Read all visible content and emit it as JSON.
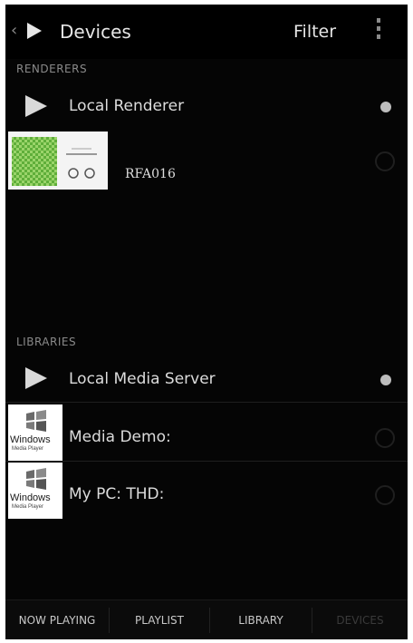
{
  "actionbar": {
    "title": "Devices",
    "filter_label": "Filter"
  },
  "renderers": {
    "header": "RENDERERS",
    "items": [
      {
        "label": "Local Renderer",
        "selected": true
      },
      {
        "label": "RFA016",
        "selected": false
      }
    ]
  },
  "libraries": {
    "header": "LIBRARIES",
    "items": [
      {
        "label": "Local Media Server",
        "selected": true
      },
      {
        "label": "Media Demo:",
        "selected": false
      },
      {
        "label": "My PC:  THD:",
        "selected": false
      }
    ]
  },
  "wmp_logo": {
    "brand": "Windows",
    "sub": "Media Player"
  },
  "tabs": [
    {
      "label": "NOW PLAYING",
      "active": true
    },
    {
      "label": "PLAYLIST",
      "active": true
    },
    {
      "label": "LIBRARY",
      "active": true
    },
    {
      "label": "DEVICES",
      "active": false
    }
  ],
  "colors": {
    "background": "#050505",
    "text_primary": "#dcdcdc",
    "text_secondary": "#8a8a8a",
    "thumb_green": "#7ec850"
  }
}
